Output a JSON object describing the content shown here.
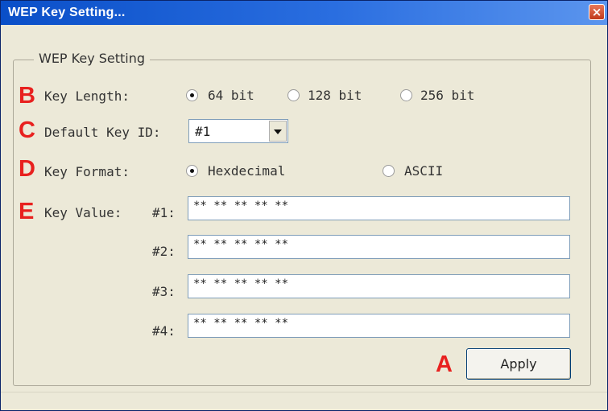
{
  "window": {
    "title": "WEP Key Setting...",
    "close_symbol": "×"
  },
  "group": {
    "title": "WEP Key Setting"
  },
  "markers": {
    "apply": "A",
    "key_length": "B",
    "default_key_id": "C",
    "key_format": "D",
    "key_value": "E"
  },
  "key_length": {
    "label": "Key Length:",
    "options": [
      "64 bit",
      "128 bit",
      "256 bit"
    ],
    "selected": "64 bit"
  },
  "default_key_id": {
    "label": "Default Key ID:",
    "value": "#1"
  },
  "key_format": {
    "label": "Key Format:",
    "options": [
      "Hexdecimal",
      "ASCII"
    ],
    "selected": "Hexdecimal"
  },
  "key_value": {
    "label": "Key Value:",
    "keys": [
      {
        "label": "#1:",
        "value": "** ** ** ** **"
      },
      {
        "label": "#2:",
        "value": "** ** ** ** **"
      },
      {
        "label": "#3:",
        "value": "** ** ** ** **"
      },
      {
        "label": "#4:",
        "value": "** ** ** ** **"
      }
    ]
  },
  "apply_button": {
    "label": "Apply"
  },
  "colors": {
    "titlebar": "#0a4fc8",
    "marker": "#e8211f",
    "dialog_bg": "#ece9d8"
  }
}
